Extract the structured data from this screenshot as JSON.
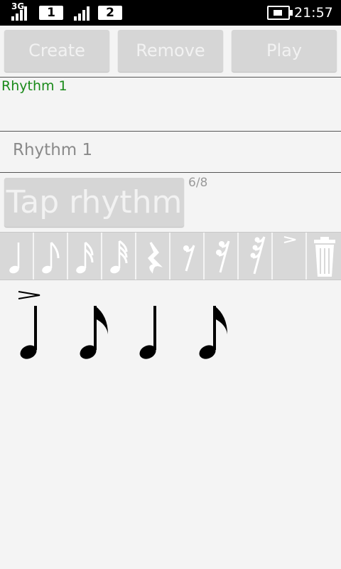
{
  "status_bar": {
    "network": "3G",
    "sim1": "1",
    "sim2": "2",
    "time": "21:57"
  },
  "toolbar": {
    "create_label": "Create",
    "remove_label": "Remove",
    "play_label": "Play"
  },
  "rhythm": {
    "title": "Rhythm 1",
    "name_value": "Rhythm 1",
    "tap_label": "Tap rhythm",
    "time_signature": "6/8"
  },
  "palette": {
    "items": [
      "quarter-note",
      "eighth-note",
      "sixteenth-note",
      "thirty-second-note",
      "quarter-rest",
      "eighth-rest",
      "sixteenth-rest",
      "thirty-second-rest",
      "accent",
      "trash"
    ]
  },
  "score": {
    "notes": [
      "quarter",
      "eighth",
      "quarter",
      "eighth"
    ],
    "accented_index": 0
  },
  "colors": {
    "accent_green": "#1a8a1a",
    "button_bg": "#d6d6d6"
  }
}
